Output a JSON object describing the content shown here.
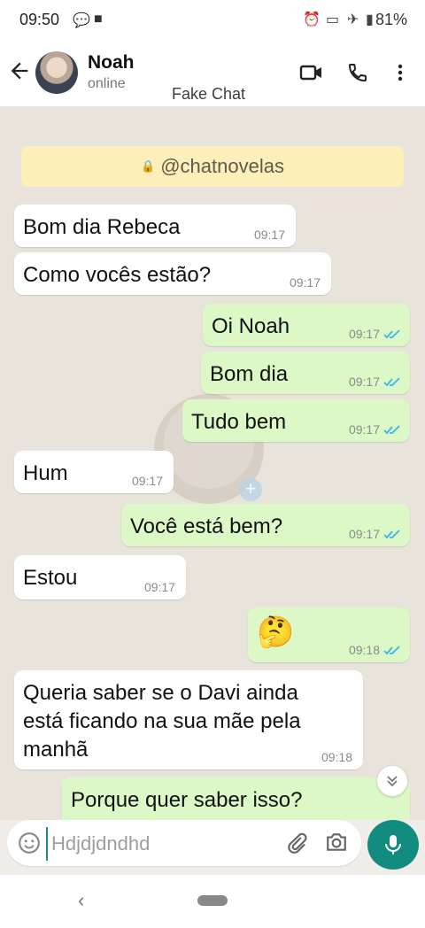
{
  "status_bar": {
    "time": "09:50",
    "battery": "81%"
  },
  "header": {
    "contact_name": "Noah",
    "contact_status": "online",
    "overlay_label": "Fake Chat"
  },
  "chat": {
    "banner": "@chatnovelas",
    "messages": [
      {
        "text": "Bom dia Rebeca",
        "time": "09:17",
        "direction": "incoming"
      },
      {
        "text": "Como vocês estão?",
        "time": "09:17",
        "direction": "incoming"
      },
      {
        "text": "Oi Noah",
        "time": "09:17",
        "direction": "outgoing"
      },
      {
        "text": "Bom dia",
        "time": "09:17",
        "direction": "outgoing"
      },
      {
        "text": "Tudo bem",
        "time": "09:17",
        "direction": "outgoing"
      },
      {
        "text": "Hum",
        "time": "09:17",
        "direction": "incoming"
      },
      {
        "text": "Você está bem?",
        "time": "09:17",
        "direction": "outgoing"
      },
      {
        "text": "Estou",
        "time": "09:17",
        "direction": "incoming"
      },
      {
        "text": "🤔",
        "time": "09:18",
        "direction": "outgoing"
      },
      {
        "text": "Queria saber se o Davi ainda",
        "text2": "está ficando na sua mãe pela",
        "text3": "manhã",
        "time": "09:18",
        "direction": "incoming"
      },
      {
        "text": "Porque quer saber isso?",
        "time": "",
        "direction": "outgoing"
      }
    ]
  },
  "composer": {
    "placeholder": "Hdjdjdndhd"
  },
  "colors": {
    "outgoing_bubble": "#dcf8c6",
    "incoming_bubble": "#ffffff",
    "accent": "#128c7e",
    "read_ticks": "#34b7f1"
  }
}
